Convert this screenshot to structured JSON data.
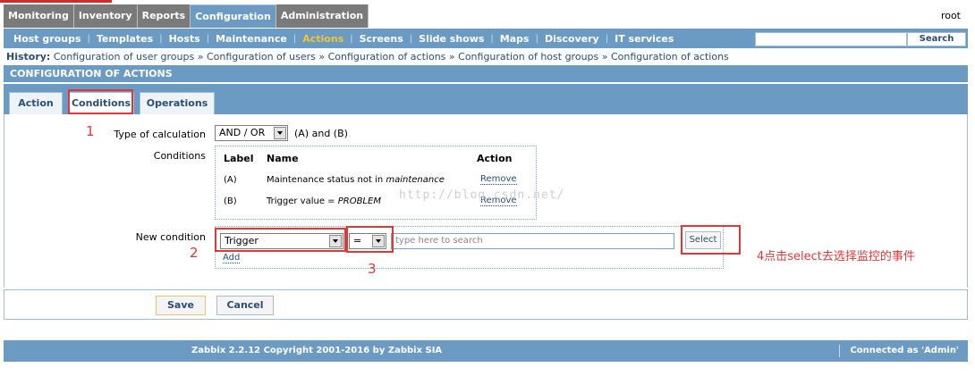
{
  "top_menu": {
    "items": [
      {
        "label": "Monitoring",
        "active": false
      },
      {
        "label": "Inventory",
        "active": false
      },
      {
        "label": "Reports",
        "active": false
      },
      {
        "label": "Configuration",
        "active": true
      },
      {
        "label": "Administration",
        "active": false
      }
    ],
    "user": "root"
  },
  "sub_menu": {
    "items": [
      {
        "label": "Host groups"
      },
      {
        "label": "Templates"
      },
      {
        "label": "Hosts"
      },
      {
        "label": "Maintenance"
      },
      {
        "label": "Actions",
        "current": true
      },
      {
        "label": "Screens"
      },
      {
        "label": "Slide shows"
      },
      {
        "label": "Maps"
      },
      {
        "label": "Discovery"
      },
      {
        "label": "IT services"
      }
    ],
    "search_button": "Search"
  },
  "history": {
    "label": "History:",
    "items": [
      "Configuration of user groups",
      "Configuration of users",
      "Configuration of actions",
      "Configuration of host groups",
      "Configuration of actions"
    ],
    "separator": "»"
  },
  "section_title": "CONFIGURATION OF ACTIONS",
  "tabs": [
    {
      "label": "Action",
      "active": false
    },
    {
      "label": "Conditions",
      "active": true
    },
    {
      "label": "Operations",
      "active": false
    }
  ],
  "form": {
    "type_of_calculation_label": "Type of calculation",
    "type_of_calculation_value": "AND / OR",
    "calculation_formula": "(A) and (B)",
    "conditions_label": "Conditions",
    "conditions_table": {
      "headers": {
        "label": "Label",
        "name": "Name",
        "action": "Action"
      },
      "rows": [
        {
          "label": "(A)",
          "name_prefix": "Maintenance status not in ",
          "name_value": "maintenance",
          "action": "Remove"
        },
        {
          "label": "(B)",
          "name_prefix": "Trigger value = ",
          "name_value": "PROBLEM",
          "action": "Remove"
        }
      ]
    },
    "new_condition_label": "New condition",
    "condition_type_value": "Trigger",
    "operator_value": "=",
    "search_placeholder": "type here to search",
    "select_button": "Select",
    "add_link": "Add"
  },
  "buttons": {
    "save": "Save",
    "cancel": "Cancel"
  },
  "footer": {
    "copyright": "Zabbix 2.2.12 Copyright 2001-2016 by Zabbix SIA",
    "connected": "Connected as 'Admin'"
  },
  "annotations": {
    "n1": "1",
    "n2": "2",
    "n3": "3",
    "note": "4点击select去选择监控的事件",
    "color": "#e03838"
  },
  "watermark": "http://blog.csdn.net/"
}
